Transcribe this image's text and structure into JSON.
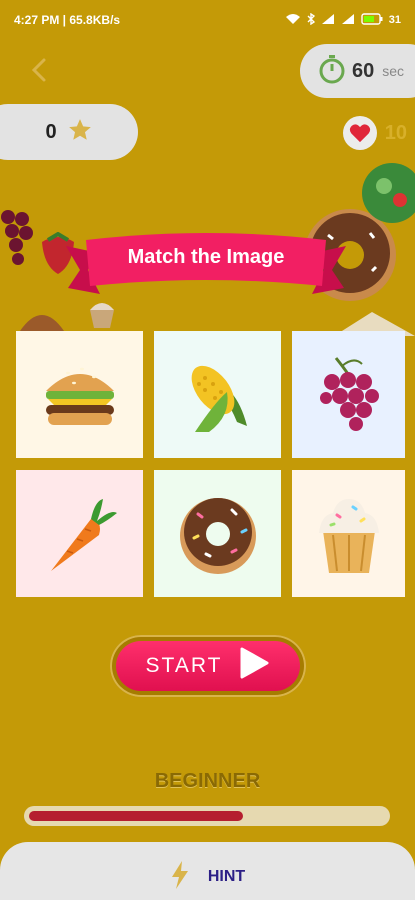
{
  "status_bar": {
    "time_speed": "4:27 PM | 65.8KB/s",
    "right": "31"
  },
  "header": {
    "timer_value": "60",
    "timer_unit": "sec",
    "score_value": "0",
    "lives_value": "10"
  },
  "banner": {
    "title": "Match the Image"
  },
  "tiles": [
    {
      "name": "burger",
      "bg": "#fff7e6"
    },
    {
      "name": "corn",
      "bg": "#eefaf7"
    },
    {
      "name": "grapes",
      "bg": "#e8f1ff"
    },
    {
      "name": "carrot",
      "bg": "#ffe8ea"
    },
    {
      "name": "donut",
      "bg": "#eefcef"
    },
    {
      "name": "cupcake",
      "bg": "#fff5e8"
    }
  ],
  "start_label": "START",
  "level": {
    "label": "BEGINNER",
    "progress": 0.6
  },
  "hint_label": "HINT",
  "colors": {
    "background": "#c49a07",
    "accent": "#ff2f6c",
    "hint": "#2c1f86"
  }
}
